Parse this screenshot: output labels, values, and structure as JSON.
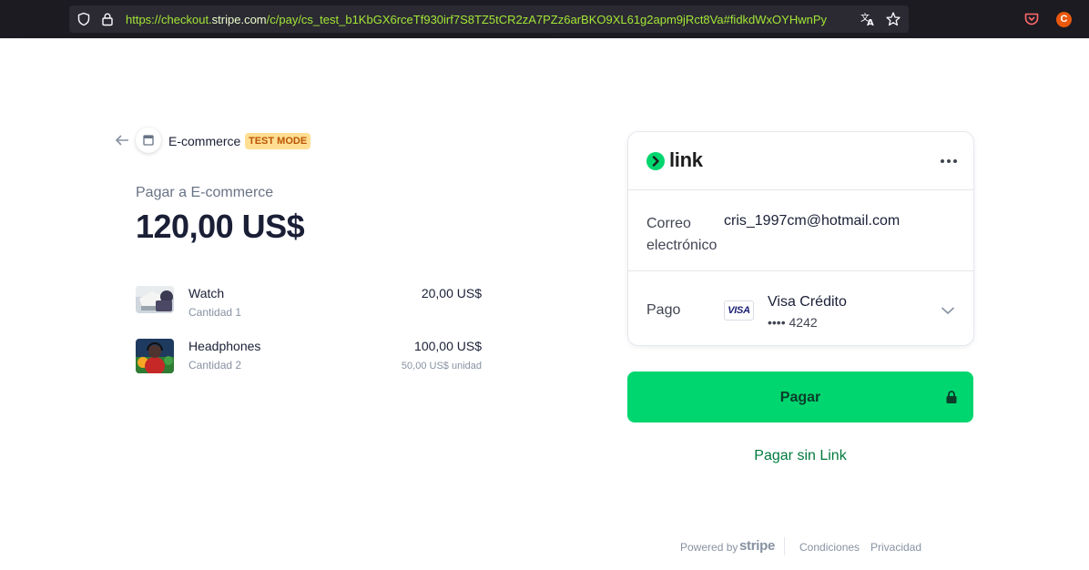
{
  "browser": {
    "url_prefix": "https://checkout.",
    "url_host": "stripe.com",
    "url_rest": "/c/pay/cs_test_b1KbGX6rceTf930irf7S8TZ5tCR2zA7PZz6arBKO9XL61g2apm9jRct8Va#fidkdWxOYHwnPy",
    "profile_initial": "C"
  },
  "merchant": {
    "name": "E-commerce",
    "badge": "TEST MODE"
  },
  "summary": {
    "pay_to": "Pagar a E-commerce",
    "total": "120,00 US$"
  },
  "items": [
    {
      "name": "Watch",
      "quantity": "Cantidad 1",
      "price": "20,00 US$",
      "unit_price": ""
    },
    {
      "name": "Headphones",
      "quantity": "Cantidad 2",
      "price": "100,00 US$",
      "unit_price": "50,00 US$ unidad"
    }
  ],
  "link": {
    "logo_text": "link",
    "email_label": "Correo electrónico",
    "email_value": "cris_1997cm@hotmail.com",
    "payment_label": "Pago",
    "card_brand": "VISA",
    "card_name": "Visa Crédito",
    "card_number": "•••• 4242"
  },
  "actions": {
    "pay_button": "Pagar",
    "pay_without_link": "Pagar sin Link"
  },
  "footer": {
    "powered_by": "Powered by",
    "stripe": "stripe",
    "terms": "Condiciones",
    "privacy": "Privacidad"
  },
  "colors": {
    "pay_button_bg": "#00d66f",
    "link_accent": "#007a3d",
    "test_badge_bg": "#ffde92",
    "test_badge_text": "#bb5504"
  },
  "icons": [
    "shield-icon",
    "lock-icon",
    "translate-icon",
    "star-icon",
    "pocket-icon",
    "back-arrow-icon",
    "store-icon",
    "link-logo-icon",
    "more-dots-icon",
    "chevron-down-icon",
    "padlock-icon"
  ]
}
